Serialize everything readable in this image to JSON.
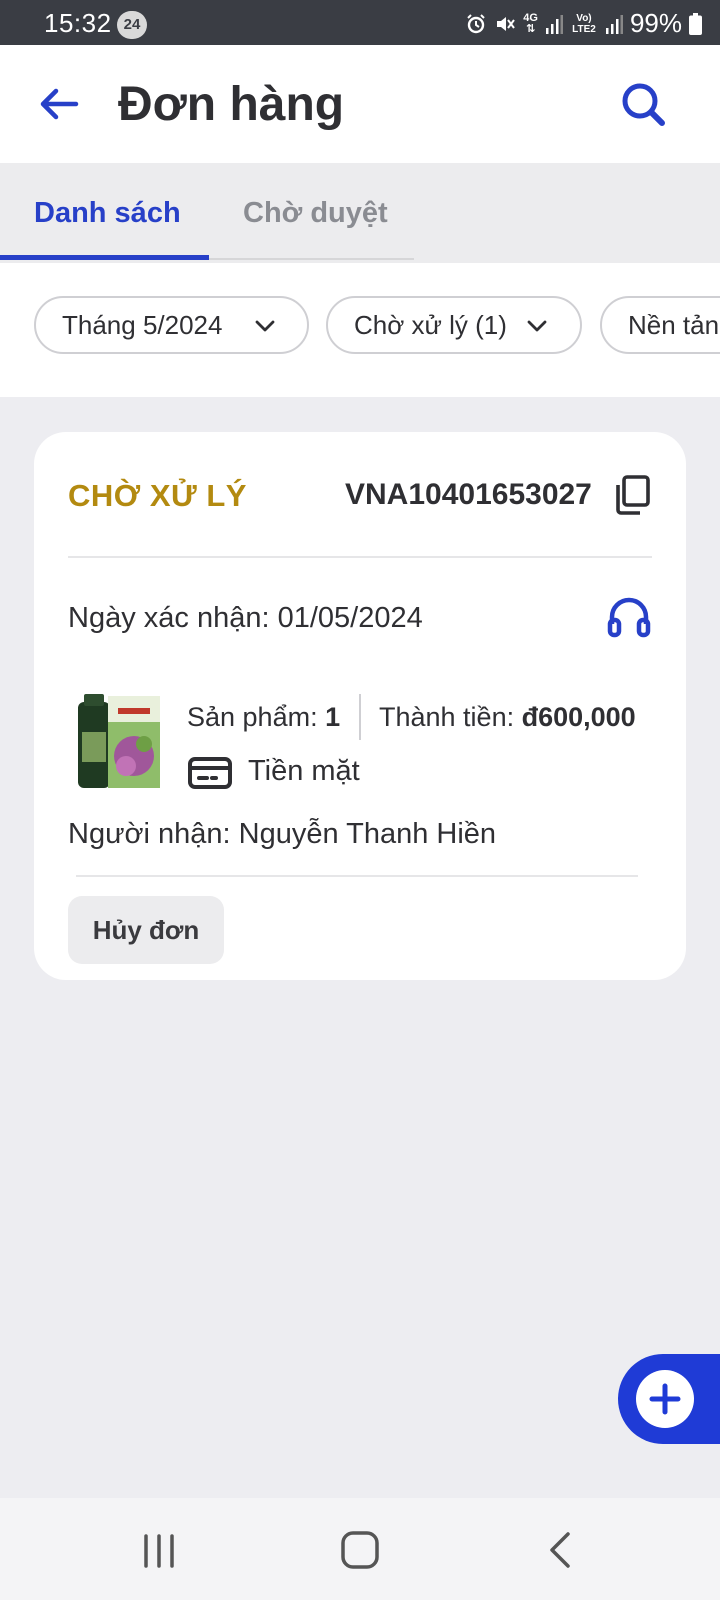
{
  "status_bar": {
    "time": "15:32",
    "notification_count": "24",
    "network": "4G",
    "sim2": "Vo) LTE2",
    "battery": "99%"
  },
  "app_bar": {
    "title": "Đơn hàng",
    "back_icon": "arrow-left-icon",
    "search_icon": "search-icon"
  },
  "tabs": [
    {
      "label": "Danh sách",
      "active": true
    },
    {
      "label": "Chờ duyệt",
      "active": false
    }
  ],
  "filters": [
    {
      "label": "Tháng 5/2024"
    },
    {
      "label": "Chờ xử lý (1)"
    },
    {
      "label": "Nền tảng"
    }
  ],
  "order": {
    "status": "CHỜ XỬ LÝ",
    "code": "VNA10401653027",
    "confirm_date_label": "Ngày xác nhận: 01/05/2024",
    "product_label": "Sản phẩm: ",
    "product_count": "1",
    "total_label": "Thành tiền: ",
    "total_value": "đ600,000",
    "payment_method": "Tiền mặt",
    "receiver": "Người nhận: Nguyễn Thanh Hiền",
    "cancel_label": "Hủy đơn"
  },
  "colors": {
    "accent": "#2740c8",
    "status_pending": "#b38a10",
    "fab": "#1f3bd6"
  }
}
